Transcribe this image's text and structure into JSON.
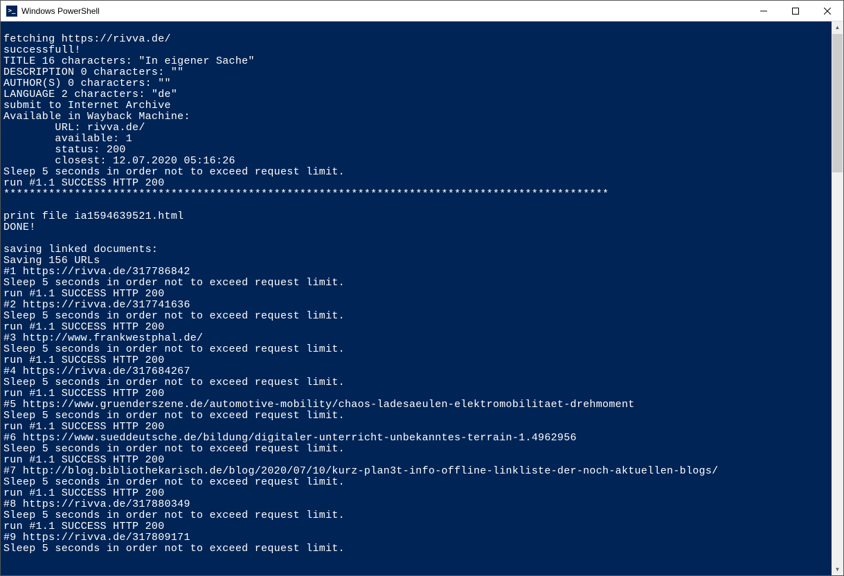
{
  "window": {
    "title": "Windows PowerShell",
    "icon_label": ">_"
  },
  "terminal": {
    "lines": [
      "fetching https://rivva.de/",
      "successfull!",
      "TITLE 16 characters: \"In eigener Sache\"",
      "DESCRIPTION 0 characters: \"\"",
      "AUTHOR(S) 0 characters: \"\"",
      "LANGUAGE 2 characters: \"de\"",
      "submit to Internet Archive",
      "Available in Wayback Machine:",
      "        URL: rivva.de/",
      "        available: 1",
      "        status: 200",
      "        closest: 12.07.2020 05:16:26",
      "Sleep 5 seconds in order not to exceed request limit.",
      "run #1.1 SUCCESS HTTP 200",
      "**********************************************************************************************",
      "",
      "print file ia1594639521.html",
      "DONE!",
      "",
      "saving linked documents:",
      "Saving 156 URLs",
      "#1 https://rivva.de/317786842",
      "Sleep 5 seconds in order not to exceed request limit.",
      "run #1.1 SUCCESS HTTP 200",
      "#2 https://rivva.de/317741636",
      "Sleep 5 seconds in order not to exceed request limit.",
      "run #1.1 SUCCESS HTTP 200",
      "#3 http://www.frankwestphal.de/",
      "Sleep 5 seconds in order not to exceed request limit.",
      "run #1.1 SUCCESS HTTP 200",
      "#4 https://rivva.de/317684267",
      "Sleep 5 seconds in order not to exceed request limit.",
      "run #1.1 SUCCESS HTTP 200",
      "#5 https://www.gruenderszene.de/automotive-mobility/chaos-ladesaeulen-elektromobilitaet-drehmoment",
      "Sleep 5 seconds in order not to exceed request limit.",
      "run #1.1 SUCCESS HTTP 200",
      "#6 https://www.sueddeutsche.de/bildung/digitaler-unterricht-unbekanntes-terrain-1.4962956",
      "Sleep 5 seconds in order not to exceed request limit.",
      "run #1.1 SUCCESS HTTP 200",
      "#7 http://blog.bibliothekarisch.de/blog/2020/07/10/kurz-plan3t-info-offline-linkliste-der-noch-aktuellen-blogs/",
      "Sleep 5 seconds in order not to exceed request limit.",
      "run #1.1 SUCCESS HTTP 200",
      "#8 https://rivva.de/317880349",
      "Sleep 5 seconds in order not to exceed request limit.",
      "run #1.1 SUCCESS HTTP 200",
      "#9 https://rivva.de/317809171",
      "Sleep 5 seconds in order not to exceed request limit."
    ]
  }
}
